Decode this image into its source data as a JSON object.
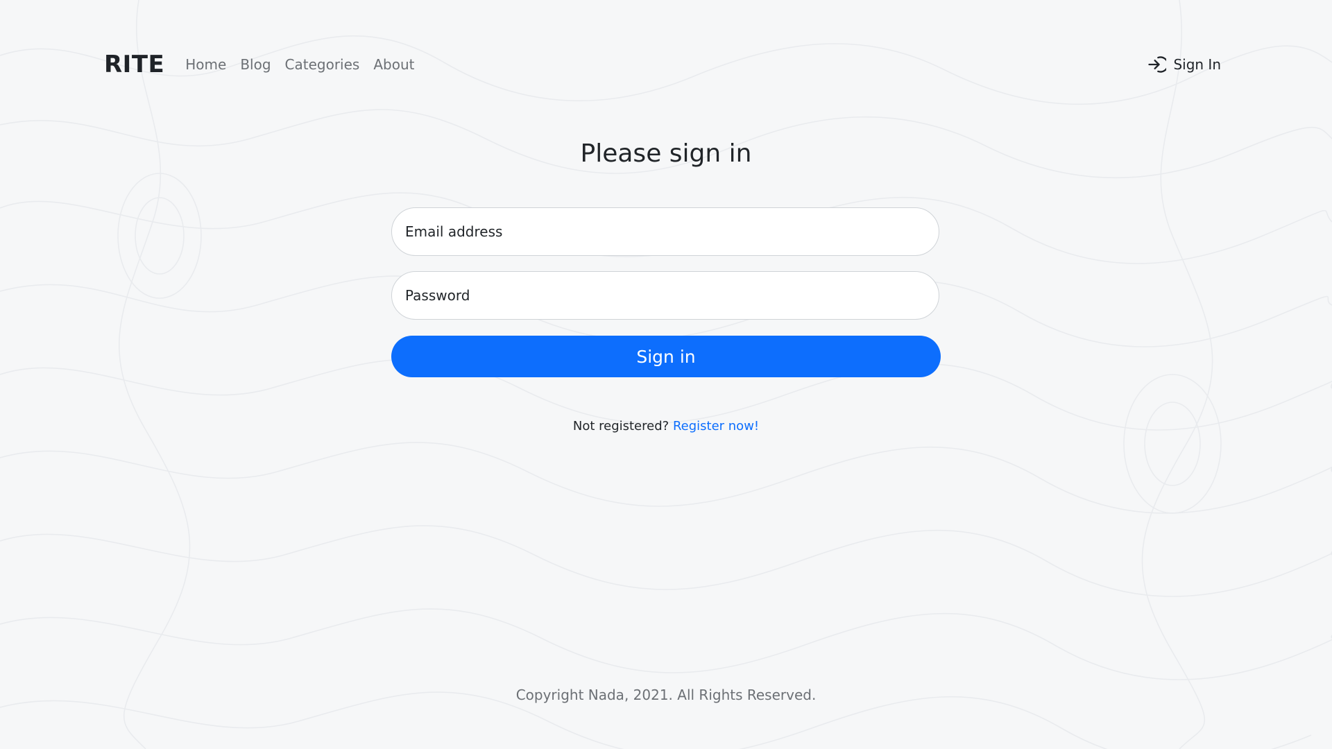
{
  "navbar": {
    "brand": "RITE",
    "links": [
      {
        "label": "Home"
      },
      {
        "label": "Blog"
      },
      {
        "label": "Categories"
      },
      {
        "label": "About"
      }
    ],
    "signin_label": "Sign In",
    "signin_icon": "sign-in-icon"
  },
  "form": {
    "heading": "Please sign in",
    "email_placeholder": "Email address",
    "email_value": "",
    "password_placeholder": "Password",
    "password_value": "",
    "submit_label": "Sign in",
    "register_prompt": "Not registered?",
    "register_link": "Register now!"
  },
  "footer": {
    "copyright": "Copyright Nada, 2021. All Rights Reserved."
  },
  "colors": {
    "background": "#f6f7f8",
    "accent": "#0d6efd",
    "text": "#212529",
    "muted": "#6c7075"
  }
}
